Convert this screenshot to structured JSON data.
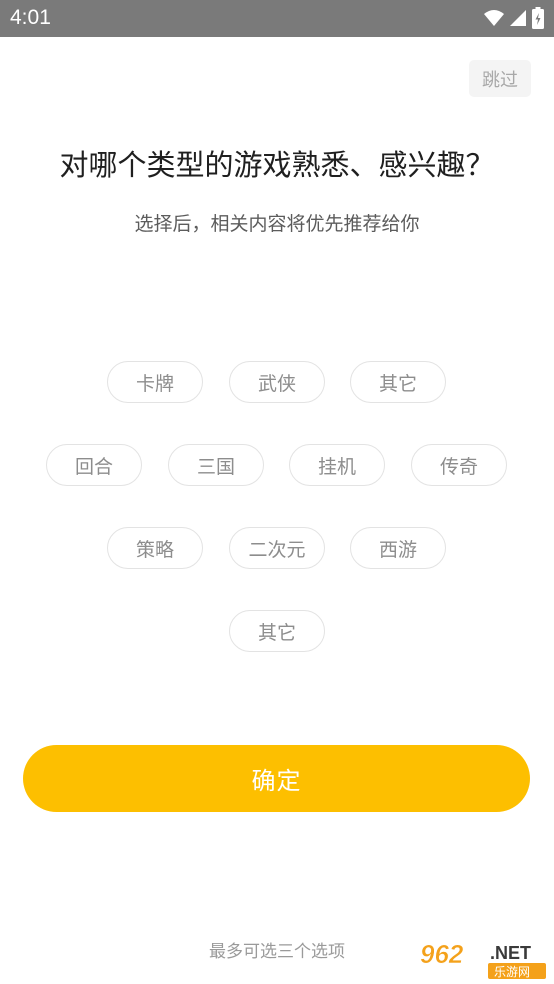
{
  "status_bar": {
    "time": "4:01"
  },
  "skip_label": "跳过",
  "title": "对哪个类型的游戏熟悉、感兴趣？",
  "subtitle": "选择后，相关内容将优先推荐给你",
  "tags": [
    "卡牌",
    "武侠",
    "其它",
    "回合",
    "三国",
    "挂机",
    "传奇",
    "策略",
    "二次元",
    "西游",
    "其它"
  ],
  "confirm_label": "确定",
  "hint": "最多可选三个选项",
  "watermark": {
    "main": "962",
    "suffix": ".NET",
    "sub": "乐游网"
  },
  "colors": {
    "accent": "#fdbf00",
    "tag_border": "#e3e3e3",
    "status_bar": "#7a7a7a"
  }
}
